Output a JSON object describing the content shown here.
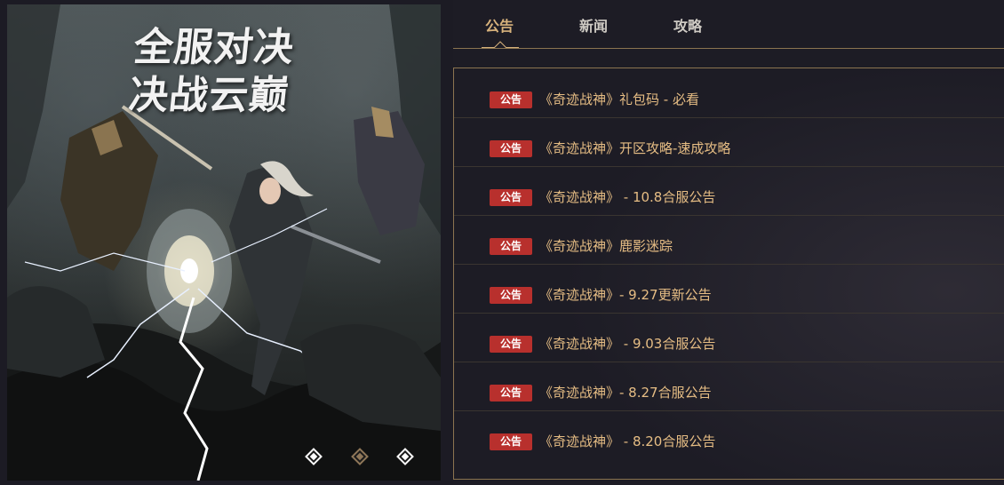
{
  "banner": {
    "headline_line1": "全服对决",
    "headline_line2": "决战云巅",
    "carousel_dots": 3,
    "active_dot": 1
  },
  "tabs": [
    {
      "label": "公告",
      "active": true
    },
    {
      "label": "新闻",
      "active": false
    },
    {
      "label": "攻略",
      "active": false
    }
  ],
  "news": [
    {
      "tag": "公告",
      "title": "《奇迹战神》礼包码 - 必看"
    },
    {
      "tag": "公告",
      "title": "《奇迹战神》开区攻略-速成攻略"
    },
    {
      "tag": "公告",
      "title": "《奇迹战神》 - 10.8合服公告"
    },
    {
      "tag": "公告",
      "title": "《奇迹战神》鹿影迷踪"
    },
    {
      "tag": "公告",
      "title": "《奇迹战神》- 9.27更新公告"
    },
    {
      "tag": "公告",
      "title": "《奇迹战神》 - 9.03合服公告"
    },
    {
      "tag": "公告",
      "title": "《奇迹战神》- 8.27合服公告"
    },
    {
      "tag": "公告",
      "title": "《奇迹战神》 - 8.20合服公告"
    }
  ],
  "colors": {
    "accent_gold": "#d7b27c",
    "title_gold": "#e6bd84",
    "badge_red": "#b8302d",
    "border_gold": "#8b7450",
    "background": "#1d1c25"
  }
}
